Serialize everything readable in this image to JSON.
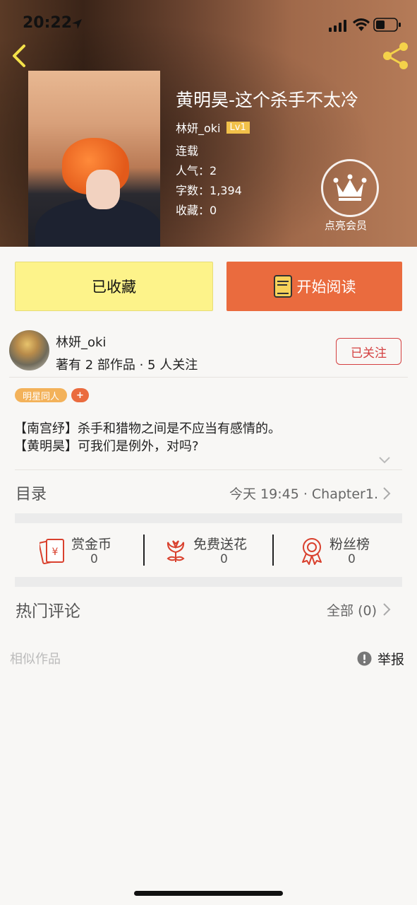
{
  "status_bar": {
    "time": "20:22"
  },
  "book": {
    "title": "黄明昊-这个杀手不太冷",
    "author": "林妍_oki",
    "level": "Lv1",
    "status": "连载",
    "popularity_label": "人气：",
    "popularity": "2",
    "words_label": "字数：",
    "words": "1,394",
    "favorites_label": "收藏：",
    "favorites": "0"
  },
  "member": {
    "label": "点亮会员"
  },
  "buttons": {
    "collected": "已收藏",
    "read": "开始阅读"
  },
  "author_card": {
    "name": "林妍_oki",
    "subtitle": "著有 2 部作品 · 5 人关注",
    "follow": "已关注"
  },
  "tags": {
    "category": "明星同人",
    "add": "+"
  },
  "description": [
    "【南宫纾】杀手和猎物之间是不应当有感情的。",
    "【黄明昊】可我们是例外，对吗?"
  ],
  "directory": {
    "title": "目录",
    "latest": "今天 19:45 · Chapter1."
  },
  "stats": {
    "reward_label": "赏金币",
    "reward_value": "0",
    "flower_label": "免费送花",
    "flower_value": "0",
    "fans_label": "粉丝榜",
    "fans_value": "0"
  },
  "comments": {
    "title": "热门评论",
    "all": "全部 (0)"
  },
  "footer": {
    "similar": "相似作品",
    "report": "举报"
  },
  "colors": {
    "accent": "#ea6b3e",
    "collected_bg": "#fdf38a",
    "follow": "#d44040",
    "icon_red": "#d9412e",
    "tag": "#f3b25a"
  },
  "icons": [
    "back-icon",
    "share-icon",
    "crown-icon",
    "book-icon",
    "chevron-right-icon",
    "chevron-down-icon",
    "red-envelope-icon",
    "flower-icon",
    "medal-icon",
    "info-icon"
  ]
}
